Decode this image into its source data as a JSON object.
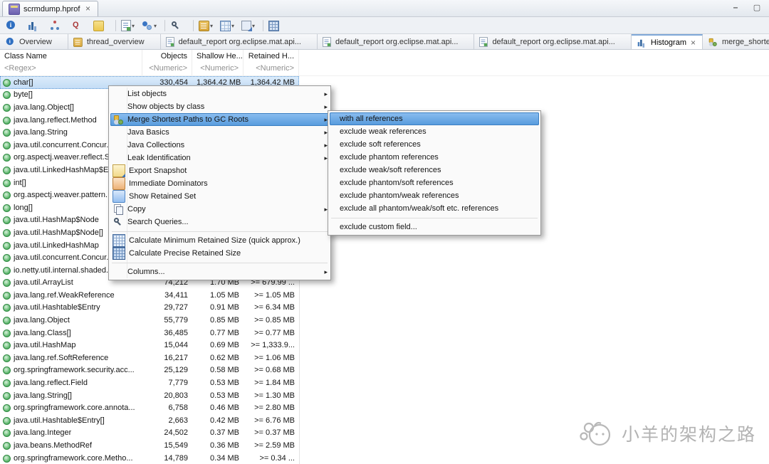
{
  "window": {
    "file_tab": {
      "label": "scrmdump.hprof",
      "icon": "hprof"
    },
    "controls": {
      "minimize": "minimize",
      "maximize": "maximize"
    }
  },
  "toolbar": {
    "buttons": [
      {
        "name": "overview",
        "icon": "info"
      },
      {
        "name": "histogram",
        "icon": "bars"
      },
      {
        "name": "dominator-tree",
        "icon": "dominator"
      },
      {
        "name": "oql",
        "icon": "oql"
      },
      {
        "name": "leak-report",
        "icon": "leak"
      },
      {
        "separator": true
      },
      {
        "name": "run-report",
        "icon": "report",
        "dropdown": true
      },
      {
        "name": "query-browser",
        "icon": "queries",
        "dropdown": true
      },
      {
        "separator": true
      },
      {
        "name": "find",
        "icon": "search"
      },
      {
        "separator": true
      },
      {
        "name": "thread-overview",
        "icon": "threads",
        "dropdown": true
      },
      {
        "name": "grouping",
        "icon": "grid",
        "dropdown": true
      },
      {
        "name": "export",
        "icon": "export",
        "dropdown": true
      },
      {
        "separator": true
      },
      {
        "name": "calculate-retained-size",
        "icon": "calc"
      }
    ]
  },
  "editor_tabs": [
    {
      "name": "overview",
      "icon": "info",
      "label": "Overview"
    },
    {
      "name": "thread-overview",
      "icon": "threads",
      "label": "thread_overview"
    },
    {
      "name": "default-report-1",
      "icon": "report",
      "label": "default_report org.eclipse.mat.api..."
    },
    {
      "name": "default-report-2",
      "icon": "report",
      "label": "default_report org.eclipse.mat.api..."
    },
    {
      "name": "default-report-3",
      "icon": "report",
      "label": "default_report org.eclipse.mat.api..."
    },
    {
      "name": "histogram",
      "icon": "bars",
      "label": "Histogram",
      "active": true,
      "closable": true
    },
    {
      "name": "merge-shortest-paths",
      "icon": "mergepaths",
      "label": "merge_shortest_paths  [selection of ..."
    }
  ],
  "table": {
    "columns": [
      "Class Name",
      "Objects",
      "Shallow He...",
      "Retained H..."
    ],
    "filters": [
      "<Regex>",
      "<Numeric>",
      "<Numeric>",
      "<Numeric>"
    ],
    "rows": [
      {
        "name": "char[]",
        "objects": "330,454",
        "shallow": "1,364.42 MB",
        "retained": "1,364.42 MB",
        "selected": true
      },
      {
        "name": "byte[]",
        "objects": "",
        "shallow": "",
        "retained": ""
      },
      {
        "name": "java.lang.Object[]",
        "objects": "",
        "shallow": "",
        "retained": ""
      },
      {
        "name": "java.lang.reflect.Method",
        "objects": "",
        "shallow": "",
        "retained": ""
      },
      {
        "name": "java.lang.String",
        "objects": "",
        "shallow": "",
        "retained": ""
      },
      {
        "name": "java.util.concurrent.Concur...",
        "objects": "",
        "shallow": "",
        "retained": ""
      },
      {
        "name": "org.aspectj.weaver.reflect.S...",
        "objects": "",
        "shallow": "",
        "retained": ""
      },
      {
        "name": "java.util.LinkedHashMap$E...",
        "objects": "",
        "shallow": "",
        "retained": ""
      },
      {
        "name": "int[]",
        "objects": "",
        "shallow": "",
        "retained": ""
      },
      {
        "name": "org.aspectj.weaver.pattern...",
        "objects": "",
        "shallow": "",
        "retained": ""
      },
      {
        "name": "long[]",
        "objects": "",
        "shallow": "",
        "retained": ""
      },
      {
        "name": "java.util.HashMap$Node",
        "objects": "",
        "shallow": "",
        "retained": ""
      },
      {
        "name": "java.util.HashMap$Node[]",
        "objects": "",
        "shallow": "",
        "retained": ""
      },
      {
        "name": "java.util.LinkedHashMap",
        "objects": "",
        "shallow": "",
        "retained": ""
      },
      {
        "name": "java.util.concurrent.Concur...",
        "objects": "",
        "shallow": "",
        "retained": ""
      },
      {
        "name": "io.netty.util.internal.shaded...",
        "objects": "",
        "shallow": "",
        "retained": ""
      },
      {
        "name": "java.util.ArrayList",
        "objects": "74,212",
        "shallow": "1.70 MB",
        "retained": ">= 679.99 ..."
      },
      {
        "name": "java.lang.ref.WeakReference",
        "objects": "34,411",
        "shallow": "1.05 MB",
        "retained": ">= 1.05 MB"
      },
      {
        "name": "java.util.Hashtable$Entry",
        "objects": "29,727",
        "shallow": "0.91 MB",
        "retained": ">= 6.34 MB"
      },
      {
        "name": "java.lang.Object",
        "objects": "55,779",
        "shallow": "0.85 MB",
        "retained": ">= 0.85 MB"
      },
      {
        "name": "java.lang.Class[]",
        "objects": "36,485",
        "shallow": "0.77 MB",
        "retained": ">= 0.77 MB"
      },
      {
        "name": "java.util.HashMap",
        "objects": "15,044",
        "shallow": "0.69 MB",
        "retained": ">= 1,333.9..."
      },
      {
        "name": "java.lang.ref.SoftReference",
        "objects": "16,217",
        "shallow": "0.62 MB",
        "retained": ">= 1.06 MB"
      },
      {
        "name": "org.springframework.security.acc...",
        "objects": "25,129",
        "shallow": "0.58 MB",
        "retained": ">= 0.68 MB"
      },
      {
        "name": "java.lang.reflect.Field",
        "objects": "7,779",
        "shallow": "0.53 MB",
        "retained": ">= 1.84 MB"
      },
      {
        "name": "java.lang.String[]",
        "objects": "20,803",
        "shallow": "0.53 MB",
        "retained": ">= 1.30 MB"
      },
      {
        "name": "org.springframework.core.annota...",
        "objects": "6,758",
        "shallow": "0.46 MB",
        "retained": ">= 2.80 MB"
      },
      {
        "name": "java.util.Hashtable$Entry[]",
        "objects": "2,663",
        "shallow": "0.42 MB",
        "retained": ">= 6.76 MB"
      },
      {
        "name": "java.lang.Integer",
        "objects": "24,502",
        "shallow": "0.37 MB",
        "retained": ">= 0.37 MB"
      },
      {
        "name": "java.beans.MethodRef",
        "objects": "15,549",
        "shallow": "0.36 MB",
        "retained": ">= 2.59 MB"
      },
      {
        "name": "org.springframework.core.Metho...",
        "objects": "14,789",
        "shallow": "0.34 MB",
        "retained": ">= 0.34 ..."
      }
    ]
  },
  "context_menu": {
    "items": [
      {
        "label": "List objects",
        "submenu": true
      },
      {
        "label": "Show objects by class",
        "submenu": true
      },
      {
        "label": "Merge Shortest Paths to GC Roots",
        "submenu": true,
        "highlighted": true,
        "icon": "mergepaths"
      },
      {
        "label": "Java Basics",
        "submenu": true
      },
      {
        "label": "Java Collections",
        "submenu": true
      },
      {
        "label": "Leak Identification",
        "submenu": true
      },
      {
        "label": "Export Snapshot",
        "icon": "exportsnap"
      },
      {
        "label": "Immediate Dominators",
        "icon": "dominators"
      },
      {
        "label": "Show Retained Set",
        "icon": "retained"
      },
      {
        "label": "Copy",
        "submenu": true,
        "icon": "copy"
      },
      {
        "label": "Search Queries...",
        "icon": "search"
      },
      {
        "separator": true
      },
      {
        "label": "Calculate Minimum Retained Size (quick approx.)",
        "icon": "calcmin"
      },
      {
        "label": "Calculate Precise Retained Size",
        "icon": "calcprec"
      },
      {
        "separator": true
      },
      {
        "label": "Columns...",
        "submenu": true
      }
    ]
  },
  "gc_roots_submenu": {
    "items": [
      {
        "label": "with all references",
        "highlighted": true
      },
      {
        "label": "exclude weak references"
      },
      {
        "label": "exclude soft references"
      },
      {
        "label": "exclude phantom references"
      },
      {
        "label": "exclude weak/soft references"
      },
      {
        "label": "exclude phantom/soft references"
      },
      {
        "label": "exclude phantom/weak references"
      },
      {
        "label": "exclude all phantom/weak/soft etc. references"
      },
      {
        "separator": true
      },
      {
        "label": "exclude custom field..."
      }
    ]
  },
  "watermark": {
    "text": "小羊的架构之路"
  },
  "colors": {
    "selection_row": "#c3dcf5",
    "menu_highlight": "#559adc",
    "class_icon_green": "#57b368",
    "chrome_gray": "#eef1f5"
  }
}
